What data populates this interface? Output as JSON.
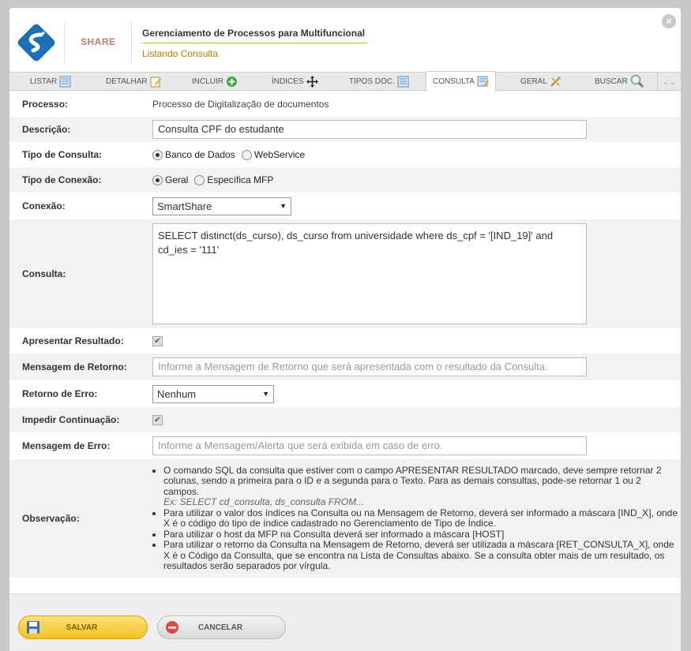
{
  "header": {
    "share_label": "SHARE",
    "title": "Gerenciamento de Processos para Multifuncional",
    "subtitle": "Listando Consulta",
    "close": "×"
  },
  "tabs": [
    {
      "label": "LISTAR",
      "icon": "list-icon"
    },
    {
      "label": "DETALHAR",
      "icon": "edit-icon"
    },
    {
      "label": "INCLUIR",
      "icon": "add-icon"
    },
    {
      "label": "ÍNDICES",
      "icon": "move-icon"
    },
    {
      "label": "TIPOS DOC.",
      "icon": "list-icon"
    },
    {
      "label": "CONSULTA",
      "icon": "query-edit-icon",
      "active": true
    },
    {
      "label": "GERAL",
      "icon": "tools-icon"
    },
    {
      "label": "BUSCAR",
      "icon": "search-icon"
    }
  ],
  "tab_scroll": "⌄⌄",
  "form": {
    "processo": {
      "label": "Processo:",
      "value": "Processo de Digitalização de documentos"
    },
    "descricao": {
      "label": "Descrição:",
      "value": "Consulta CPF do estudante"
    },
    "tipo_consulta": {
      "label": "Tipo de Consulta:",
      "options": [
        "Banco de Dados",
        "WebService"
      ],
      "selected": "Banco de Dados"
    },
    "tipo_conexao": {
      "label": "Tipo de Conexão:",
      "options": [
        "Geral",
        "Específica MFP"
      ],
      "selected": "Geral"
    },
    "conexao": {
      "label": "Conexão:",
      "value": "SmartShare"
    },
    "consulta": {
      "label": "Consulta:",
      "value": "SELECT distinct(ds_curso), ds_curso from universidade where ds_cpf = '[IND_19]' and cd_ies = '111'"
    },
    "apresentar": {
      "label": "Apresentar Resultado:",
      "checked": true
    },
    "msg_retorno": {
      "label": "Mensagem de Retorno:",
      "placeholder": "Informe a Mensagem de Retorno que será apresentada com o resultado da Consulta."
    },
    "retorno_erro": {
      "label": "Retorno de Erro:",
      "value": "Nenhum"
    },
    "impedir": {
      "label": "Impedir Continuação:",
      "checked": true
    },
    "msg_erro": {
      "label": "Mensagem de Erro:",
      "placeholder": "Informe a Mensagem/Alerta que será exibida em caso de erro."
    },
    "observacao": {
      "label": "Observação:",
      "items": [
        "O comando SQL da consulta que estiver com o campo APRESENTAR RESULTADO marcado, deve sempre retornar 2 colunas, sendo a primeira para o ID e a segunda para o Texto. Para as demais consultas, pode-se retornar 1 ou 2 campos.",
        "Para utilizar o valor dos índices na Consulta ou na Mensagem de Retorno, deverá ser informado a máscara [IND_X], onde X é o código do tipo de índice cadastrado no Gerenciamento de Tipo de Índice.",
        "Para utilizar o host da MFP na Consulta deverá ser informado a máscara [HOST]",
        "Para utilizar o retorno da Consulta na Mensagem de Retorno, deverá ser utilizada a máscara [RET_CONSULTA_X], onde X é o Código da Consulta, que se encontra na Lista de Consultas abaixo. Se a consulta obter mais de um resultado, os resultados serão separados por vírgula."
      ],
      "example": "Ex: SELECT cd_consulta, ds_consulta FROM..."
    }
  },
  "footer": {
    "save_label": "SALVAR",
    "cancel_label": "CANCELAR"
  },
  "colors": {
    "accent": "#f4c11e",
    "subtitle": "#c97a00",
    "title_underline": "#e8b400"
  }
}
